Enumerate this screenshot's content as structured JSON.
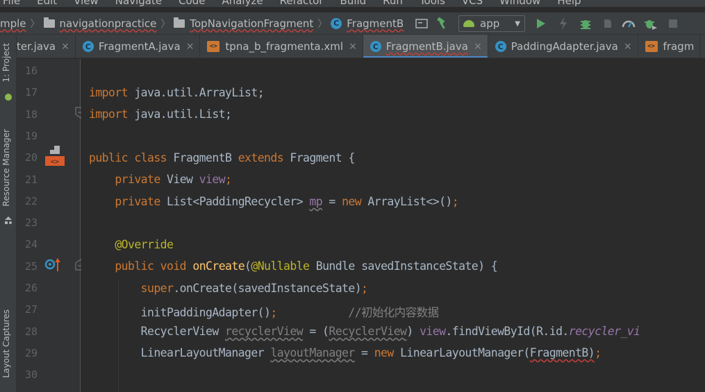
{
  "menu": [
    "File",
    "Edit",
    "View",
    "Navigate",
    "Code",
    "Analyze",
    "Refactor",
    "Build",
    "Run",
    "Tools",
    "VCS",
    "Window",
    "Help"
  ],
  "breadcrumbs": [
    {
      "label": "mple",
      "icon": "none"
    },
    {
      "label": "navigationpractice",
      "icon": "folder-icon"
    },
    {
      "label": "TopNavigationFragment",
      "icon": "folder-icon"
    },
    {
      "label": "FragmentB",
      "icon": "class-icon"
    }
  ],
  "class_icon_letter": "C",
  "run_config": "app",
  "tabs": [
    {
      "label": "ter.java",
      "icon": "none",
      "active": false
    },
    {
      "label": "FragmentA.java",
      "icon": "class-icon",
      "active": false
    },
    {
      "label": "tpna_b_fragmenta.xml",
      "icon": "xml-icon",
      "active": false
    },
    {
      "label": "FragmentB.java",
      "icon": "class-icon",
      "active": true
    },
    {
      "label": "PaddingAdapter.java",
      "icon": "class-icon",
      "active": false
    },
    {
      "label": "fragm",
      "icon": "xml-icon",
      "active": false
    }
  ],
  "tab_close_glyph": "×",
  "xml_icon_text": "<>",
  "side_tools": {
    "project": "1: Project",
    "resource_manager": "Resource Manager",
    "layout_captures": "Layout Captures"
  },
  "line_numbers": [
    "16",
    "17",
    "18",
    "19",
    "20",
    "21",
    "22",
    "23",
    "24",
    "25",
    "26",
    "27",
    "28",
    "29",
    "30"
  ],
  "code": {
    "l17_kw": "import",
    "l17_rest": " java.util.ArrayList;",
    "l18_kw": "import",
    "l18_rest": " java.util.List;",
    "l20_kw1": "public class",
    "l20_name": " FragmentB ",
    "l20_kw2": "extends",
    "l20_rest": " Fragment {",
    "l21_kw": "private",
    "l21_type": " View ",
    "l21_field": "view",
    "l21_end": ";",
    "l22_kw": "private",
    "l22_type": " List<PaddingRecycler> ",
    "l22_field": "mp",
    "l22_mid": " = ",
    "l22_new": "new",
    "l22_rest": " ArrayList<>()",
    "l22_end": ";",
    "l24_anno": "@Override",
    "l25_kw": "public void",
    "l25_sp": " ",
    "l25_fn": "onCreate",
    "l25_p": "(",
    "l25_anno": "@Nullable",
    "l25_rest": " Bundle savedInstanceState) {",
    "l26_kw": "super",
    "l26_rest": ".onCreate(savedInstanceState)",
    "l26_end": ";",
    "l27_call": "initPaddingAdapter()",
    "l27_end": ";",
    "l27_gap": "           ",
    "l27_comment": "//初始化内容数据",
    "l28_type": "RecyclerView ",
    "l28_var": "recyclerView",
    "l28_mid": " = (",
    "l28_cast": "RecyclerView",
    "l28_close": ") ",
    "l28_field": "view",
    "l28_call": ".findViewById(R.id.",
    "l28_id": "recycler_vi",
    "l29_type": "LinearLayoutManager ",
    "l29_var": "layoutManager",
    "l29_mid": " = ",
    "l29_new": "new",
    "l29_call": " LinearLayoutManager(",
    "l29_arg": "FragmentB)",
    "l29_end": ";"
  },
  "colors": {
    "keyword": "#cc7832",
    "annotation": "#bbb529",
    "field": "#9876aa",
    "method": "#ffc66d",
    "comment": "#808080",
    "text": "#a9b7c6",
    "accent": "#4a88c7"
  }
}
